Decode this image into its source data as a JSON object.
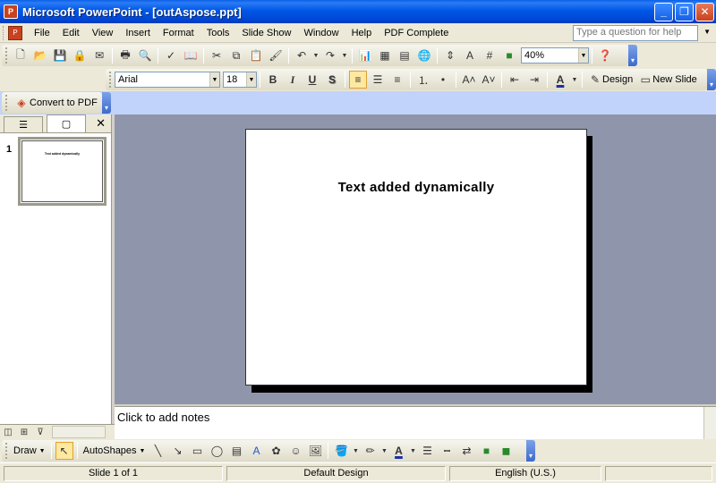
{
  "window": {
    "title": "Microsoft PowerPoint - [outAspose.ppt]",
    "app_icon": "powerpoint-icon",
    "minimize_label": "_",
    "maximize_label": "❐",
    "close_label": "✕"
  },
  "menu": {
    "items": [
      "File",
      "Edit",
      "View",
      "Insert",
      "Format",
      "Tools",
      "Slide Show",
      "Window",
      "Help",
      "PDF Complete"
    ],
    "ask_placeholder": "Type a question for help"
  },
  "standard_toolbar": {
    "zoom": "40%"
  },
  "formatting_toolbar": {
    "font": "Arial",
    "size": "18",
    "bold": "B",
    "italic": "I",
    "underline": "U",
    "shadow": "S",
    "design_label": "Design",
    "new_slide_label": "New Slide"
  },
  "pdf_toolbar": {
    "convert_label": "Convert to PDF"
  },
  "left_panel": {
    "slide_number": "1",
    "thumbnail_text": "Text added dynamically",
    "close_label": "✕"
  },
  "slide": {
    "text": "Text added dynamically"
  },
  "notes": {
    "placeholder": "Click to add notes"
  },
  "draw_toolbar": {
    "draw_label": "Draw",
    "autoshapes_label": "AutoShapes"
  },
  "status": {
    "slide_info": "Slide 1 of 1",
    "design": "Default Design",
    "language": "English (U.S.)"
  }
}
